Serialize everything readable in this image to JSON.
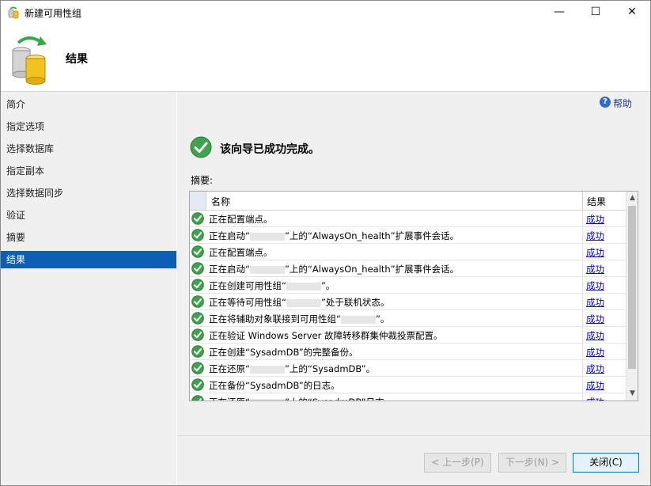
{
  "window": {
    "title": "新建可用性组",
    "controls": {
      "minimize": "—",
      "maximize": "☐",
      "close": "✕"
    }
  },
  "header": {
    "title": "结果"
  },
  "sidebar": {
    "items": [
      {
        "label": "简介"
      },
      {
        "label": "指定选项"
      },
      {
        "label": "选择数据库"
      },
      {
        "label": "指定副本"
      },
      {
        "label": "选择数据同步"
      },
      {
        "label": "验证"
      },
      {
        "label": "摘要"
      },
      {
        "label": "结果",
        "active": true
      }
    ]
  },
  "main": {
    "help_label": "帮助",
    "success_message": "该向导已成功完成。",
    "summary_label": "摘要:",
    "grid": {
      "columns": [
        "名称",
        "结果"
      ],
      "rows": [
        {
          "name_before": "正在配置端点。",
          "redacted": false,
          "name_after": "",
          "result": "成功"
        },
        {
          "name_before": "正在启动“",
          "redacted": true,
          "name_after": "”上的“AlwaysOn_health”扩展事件会话。",
          "result": "成功"
        },
        {
          "name_before": "正在配置端点。",
          "redacted": false,
          "name_after": "",
          "result": "成功"
        },
        {
          "name_before": "正在启动“",
          "redacted": true,
          "name_after": "”上的“AlwaysOn_health”扩展事件会话。",
          "result": "成功"
        },
        {
          "name_before": "正在创建可用性组“",
          "redacted": true,
          "name_after": "”。",
          "result": "成功"
        },
        {
          "name_before": "正在等待可用性组“",
          "redacted": true,
          "name_after": "”处于联机状态。",
          "result": "成功"
        },
        {
          "name_before": "正在将辅助对象联接到可用性组“",
          "redacted": true,
          "name_after": "”。",
          "result": "成功"
        },
        {
          "name_before": "正在验证 Windows Server 故障转移群集仲裁投票配置。",
          "redacted": false,
          "name_after": "",
          "result": "成功"
        },
        {
          "name_before": "正在创建“SysadmDB”的完整备份。",
          "redacted": false,
          "name_after": "",
          "result": "成功"
        },
        {
          "name_before": "正在还原“",
          "redacted": true,
          "name_after": "”上的“SysadmDB”。",
          "result": "成功"
        },
        {
          "name_before": "正在备份“SysadmDB”的日志。",
          "redacted": false,
          "name_after": "",
          "result": "成功"
        },
        {
          "name_before": "正在还原“",
          "redacted": true,
          "name_after": "”上的“SysadmDB”日志。",
          "result": "成功"
        }
      ]
    }
  },
  "footer": {
    "back_label": "< 上一步(P)",
    "next_label": "下一步(N) >",
    "close_label": "关闭(C)"
  },
  "colors": {
    "accent": "#0c5fb4",
    "success": "#3fa34d",
    "link": "#0000ee"
  }
}
